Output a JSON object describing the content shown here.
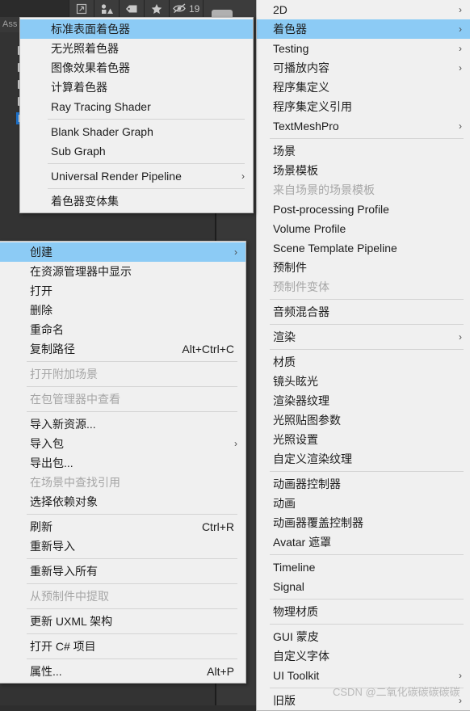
{
  "app": {
    "project_panel_title": "Ass",
    "hidden_count": "19"
  },
  "toolbar": {
    "buttons": [
      {
        "name": "open-in-new-window-icon",
        "label": ""
      },
      {
        "name": "gizmos-icon",
        "label": ""
      },
      {
        "name": "tag-icon",
        "label": ""
      },
      {
        "name": "favorite-star-icon",
        "label": ""
      }
    ],
    "hidden_objects_label": "19"
  },
  "shader_menu": {
    "items": [
      {
        "label": "标准表面着色器",
        "highlight": true,
        "disabled": false,
        "arrow": false,
        "shortcut": ""
      },
      {
        "label": "无光照着色器",
        "highlight": false,
        "disabled": false,
        "arrow": false,
        "shortcut": ""
      },
      {
        "label": "图像效果着色器",
        "highlight": false,
        "disabled": false,
        "arrow": false,
        "shortcut": ""
      },
      {
        "label": "计算着色器",
        "highlight": false,
        "disabled": false,
        "arrow": false,
        "shortcut": ""
      },
      {
        "label": "Ray Tracing Shader",
        "highlight": false,
        "disabled": false,
        "arrow": false,
        "shortcut": ""
      },
      {
        "separator": true
      },
      {
        "label": "Blank Shader Graph",
        "highlight": false,
        "disabled": false,
        "arrow": false,
        "shortcut": ""
      },
      {
        "label": "Sub Graph",
        "highlight": false,
        "disabled": false,
        "arrow": false,
        "shortcut": ""
      },
      {
        "separator": true
      },
      {
        "label": "Universal Render Pipeline",
        "highlight": false,
        "disabled": false,
        "arrow": true,
        "shortcut": ""
      },
      {
        "separator": true
      },
      {
        "label": "着色器变体集",
        "highlight": false,
        "disabled": false,
        "arrow": false,
        "shortcut": ""
      }
    ]
  },
  "context_menu": {
    "items": [
      {
        "label": "创建",
        "highlight": true,
        "disabled": false,
        "arrow": true,
        "shortcut": ""
      },
      {
        "label": "在资源管理器中显示",
        "highlight": false,
        "disabled": false,
        "arrow": false,
        "shortcut": ""
      },
      {
        "label": "打开",
        "highlight": false,
        "disabled": false,
        "arrow": false,
        "shortcut": ""
      },
      {
        "label": "删除",
        "highlight": false,
        "disabled": false,
        "arrow": false,
        "shortcut": ""
      },
      {
        "label": "重命名",
        "highlight": false,
        "disabled": false,
        "arrow": false,
        "shortcut": ""
      },
      {
        "label": "复制路径",
        "highlight": false,
        "disabled": false,
        "arrow": false,
        "shortcut": "Alt+Ctrl+C"
      },
      {
        "separator": true
      },
      {
        "label": "打开附加场景",
        "highlight": false,
        "disabled": true,
        "arrow": false,
        "shortcut": ""
      },
      {
        "separator": true
      },
      {
        "label": "在包管理器中查看",
        "highlight": false,
        "disabled": true,
        "arrow": false,
        "shortcut": ""
      },
      {
        "separator": true
      },
      {
        "label": "导入新资源...",
        "highlight": false,
        "disabled": false,
        "arrow": false,
        "shortcut": ""
      },
      {
        "label": "导入包",
        "highlight": false,
        "disabled": false,
        "arrow": true,
        "shortcut": ""
      },
      {
        "label": "导出包...",
        "highlight": false,
        "disabled": false,
        "arrow": false,
        "shortcut": ""
      },
      {
        "label": "在场景中查找引用",
        "highlight": false,
        "disabled": true,
        "arrow": false,
        "shortcut": ""
      },
      {
        "label": "选择依赖对象",
        "highlight": false,
        "disabled": false,
        "arrow": false,
        "shortcut": ""
      },
      {
        "separator": true
      },
      {
        "label": "刷新",
        "highlight": false,
        "disabled": false,
        "arrow": false,
        "shortcut": "Ctrl+R"
      },
      {
        "label": "重新导入",
        "highlight": false,
        "disabled": false,
        "arrow": false,
        "shortcut": ""
      },
      {
        "separator": true
      },
      {
        "label": "重新导入所有",
        "highlight": false,
        "disabled": false,
        "arrow": false,
        "shortcut": ""
      },
      {
        "separator": true
      },
      {
        "label": "从预制件中提取",
        "highlight": false,
        "disabled": true,
        "arrow": false,
        "shortcut": ""
      },
      {
        "separator": true
      },
      {
        "label": "更新 UXML 架构",
        "highlight": false,
        "disabled": false,
        "arrow": false,
        "shortcut": ""
      },
      {
        "separator": true
      },
      {
        "label": "打开 C# 项目",
        "highlight": false,
        "disabled": false,
        "arrow": false,
        "shortcut": ""
      },
      {
        "separator": true
      },
      {
        "label": "属性...",
        "highlight": false,
        "disabled": false,
        "arrow": false,
        "shortcut": "Alt+P"
      }
    ]
  },
  "create_menu": {
    "items": [
      {
        "label": "2D",
        "highlight": false,
        "disabled": false,
        "arrow": true,
        "shortcut": ""
      },
      {
        "label": "着色器",
        "highlight": true,
        "disabled": false,
        "arrow": true,
        "shortcut": ""
      },
      {
        "label": "Testing",
        "highlight": false,
        "disabled": false,
        "arrow": true,
        "shortcut": ""
      },
      {
        "label": "可播放内容",
        "highlight": false,
        "disabled": false,
        "arrow": true,
        "shortcut": ""
      },
      {
        "label": "程序集定义",
        "highlight": false,
        "disabled": false,
        "arrow": false,
        "shortcut": ""
      },
      {
        "label": "程序集定义引用",
        "highlight": false,
        "disabled": false,
        "arrow": false,
        "shortcut": ""
      },
      {
        "label": "TextMeshPro",
        "highlight": false,
        "disabled": false,
        "arrow": true,
        "shortcut": ""
      },
      {
        "separator": true
      },
      {
        "label": "场景",
        "highlight": false,
        "disabled": false,
        "arrow": false,
        "shortcut": ""
      },
      {
        "label": "场景模板",
        "highlight": false,
        "disabled": false,
        "arrow": false,
        "shortcut": ""
      },
      {
        "label": "来自场景的场景模板",
        "highlight": false,
        "disabled": true,
        "arrow": false,
        "shortcut": ""
      },
      {
        "label": "Post-processing Profile",
        "highlight": false,
        "disabled": false,
        "arrow": false,
        "shortcut": ""
      },
      {
        "label": "Volume Profile",
        "highlight": false,
        "disabled": false,
        "arrow": false,
        "shortcut": ""
      },
      {
        "label": "Scene Template Pipeline",
        "highlight": false,
        "disabled": false,
        "arrow": false,
        "shortcut": ""
      },
      {
        "label": "预制件",
        "highlight": false,
        "disabled": false,
        "arrow": false,
        "shortcut": ""
      },
      {
        "label": "预制件变体",
        "highlight": false,
        "disabled": true,
        "arrow": false,
        "shortcut": ""
      },
      {
        "separator": true
      },
      {
        "label": "音频混合器",
        "highlight": false,
        "disabled": false,
        "arrow": false,
        "shortcut": ""
      },
      {
        "separator": true
      },
      {
        "label": "渲染",
        "highlight": false,
        "disabled": false,
        "arrow": true,
        "shortcut": ""
      },
      {
        "separator": true
      },
      {
        "label": "材质",
        "highlight": false,
        "disabled": false,
        "arrow": false,
        "shortcut": ""
      },
      {
        "label": "镜头眩光",
        "highlight": false,
        "disabled": false,
        "arrow": false,
        "shortcut": ""
      },
      {
        "label": "渲染器纹理",
        "highlight": false,
        "disabled": false,
        "arrow": false,
        "shortcut": ""
      },
      {
        "label": "光照贴图参数",
        "highlight": false,
        "disabled": false,
        "arrow": false,
        "shortcut": ""
      },
      {
        "label": "光照设置",
        "highlight": false,
        "disabled": false,
        "arrow": false,
        "shortcut": ""
      },
      {
        "label": "自定义渲染纹理",
        "highlight": false,
        "disabled": false,
        "arrow": false,
        "shortcut": ""
      },
      {
        "separator": true
      },
      {
        "label": "动画器控制器",
        "highlight": false,
        "disabled": false,
        "arrow": false,
        "shortcut": ""
      },
      {
        "label": "动画",
        "highlight": false,
        "disabled": false,
        "arrow": false,
        "shortcut": ""
      },
      {
        "label": "动画器覆盖控制器",
        "highlight": false,
        "disabled": false,
        "arrow": false,
        "shortcut": ""
      },
      {
        "label": "Avatar 遮罩",
        "highlight": false,
        "disabled": false,
        "arrow": false,
        "shortcut": ""
      },
      {
        "separator": true
      },
      {
        "label": "Timeline",
        "highlight": false,
        "disabled": false,
        "arrow": false,
        "shortcut": ""
      },
      {
        "label": "Signal",
        "highlight": false,
        "disabled": false,
        "arrow": false,
        "shortcut": ""
      },
      {
        "separator": true
      },
      {
        "label": "物理材质",
        "highlight": false,
        "disabled": false,
        "arrow": false,
        "shortcut": ""
      },
      {
        "separator": true
      },
      {
        "label": "GUI 蒙皮",
        "highlight": false,
        "disabled": false,
        "arrow": false,
        "shortcut": ""
      },
      {
        "label": "自定义字体",
        "highlight": false,
        "disabled": false,
        "arrow": false,
        "shortcut": ""
      },
      {
        "label": "UI Toolkit",
        "highlight": false,
        "disabled": false,
        "arrow": true,
        "shortcut": ""
      },
      {
        "separator": true
      },
      {
        "label": "旧版",
        "highlight": false,
        "disabled": false,
        "arrow": true,
        "shortcut": ""
      }
    ]
  },
  "watermark": {
    "text": "CSDN @二氧化碳碳碳碳碳"
  },
  "colors": {
    "highlight": "#8ccbf5",
    "menu_bg": "#f0f0f0",
    "editor_bg": "#383838",
    "panel_bg": "#333333"
  }
}
